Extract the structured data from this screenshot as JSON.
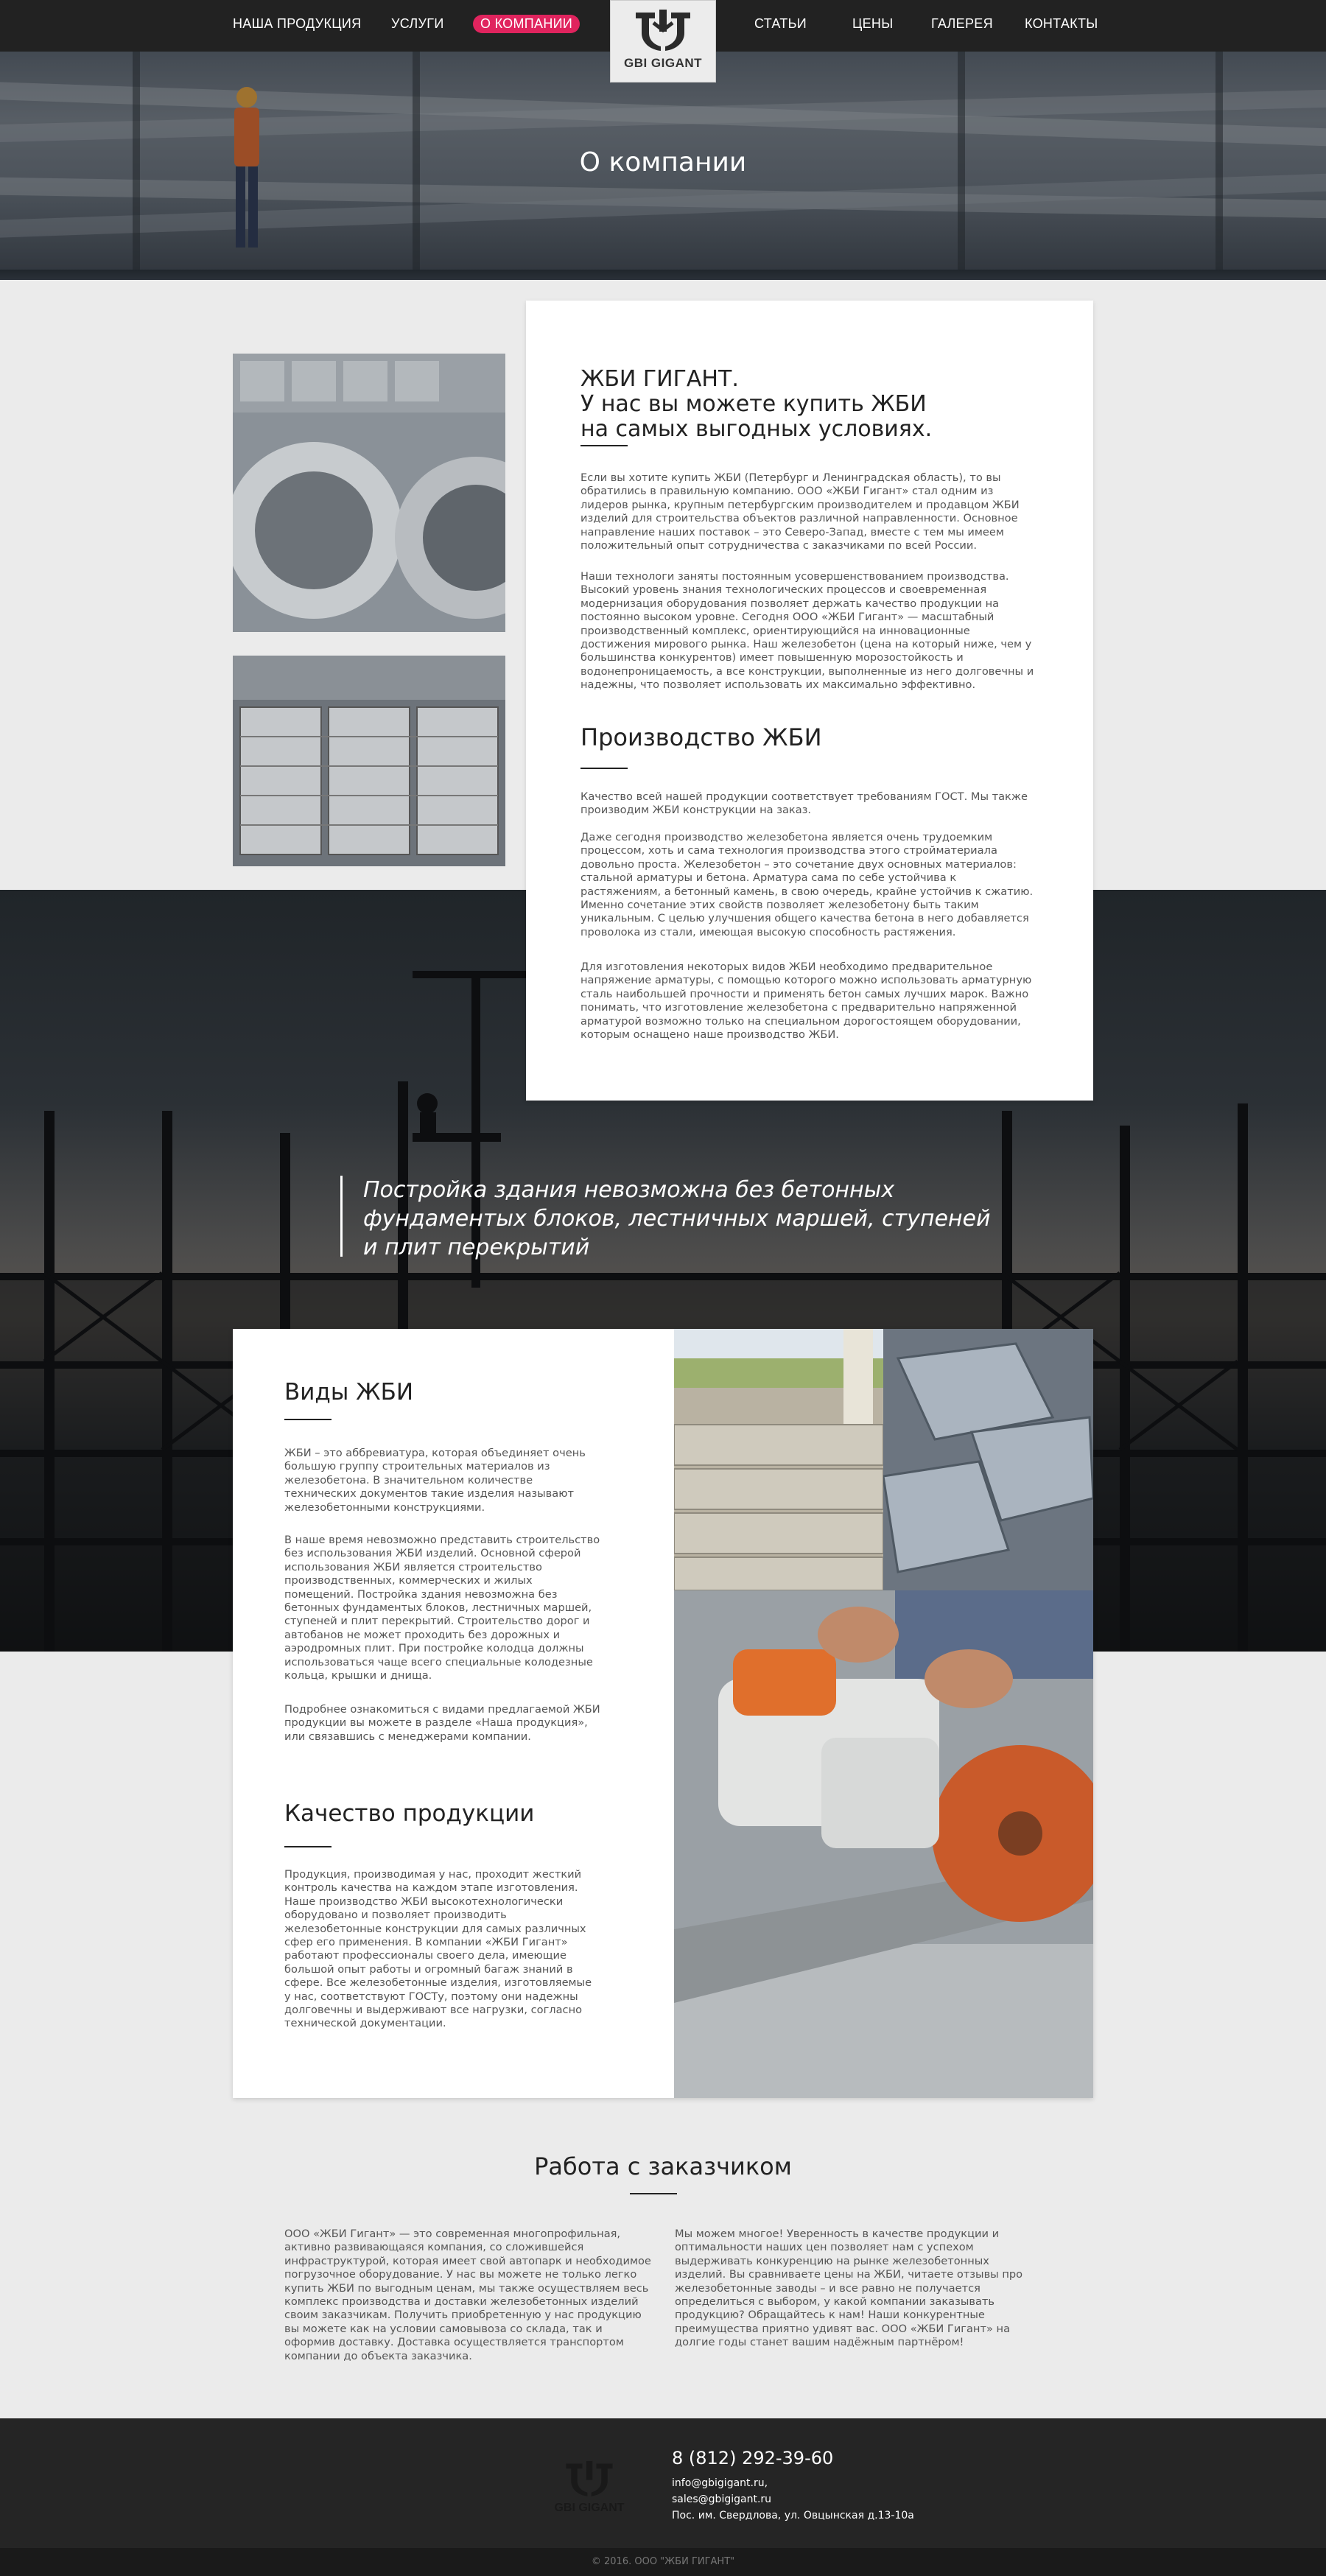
{
  "nav": {
    "items_left": [
      "НАША ПРОДУКЦИЯ",
      "УСЛУГИ",
      "О КОМПАНИИ"
    ],
    "items_right": [
      "СТАТЬИ",
      "ЦЕНЫ",
      "ГАЛЕРЕЯ",
      "КОНТАКТЫ"
    ],
    "active": "О КОМПАНИИ",
    "accent_color": "#e0245e",
    "logo_text": "GBI GIGANT"
  },
  "hero": {
    "title": "О компании"
  },
  "about": {
    "heading_lines": [
      "ЖБИ ГИГАНТ.",
      "У нас вы можете купить ЖБИ",
      "на самых выгодных условиях."
    ],
    "paragraphs": [
      "Если вы хотите купить ЖБИ (Петербург и Ленинградская область), то вы обратились в правильную компанию. ООО «ЖБИ Гигант» стал одним из лидеров рынка, крупным петербургским производителем и продавцом ЖБИ изделий для строительства объектов различной направленности. Основное направление наших поставок – это Северо-Запад, вместе с тем мы имеем положительный опыт сотрудничества с заказчиками по всей России.",
      "Наши технологи заняты постоянным усовершенствованием производства. Высокий уровень знания технологических процессов и своевременная модернизация оборудования позволяет держать качество продукции на постоянно высоком уровне. Сегодня ООО «ЖБИ Гигант» — масштабный производственный комплекс, ориентирующийся на инновационные достижения мирового рынка. Наш железобетон (цена на который ниже, чем у большинства конкурентов) имеет повышенную морозостойкость и водонепроницаемость, а все конструкции, выполненные из него долговечны и надежны, что позволяет использовать их максимально эффективно."
    ],
    "production_heading": "Производство ЖБИ",
    "production_paragraphs": [
      "Качество всей нашей продукции соответствует требованиям ГОСТ. Мы также производим ЖБИ конструкции на заказ.",
      "Даже сегодня производство железобетона является очень трудоемким процессом, хоть и сама технология производства этого стройматериала довольно проста. Железобетон – это сочетание двух основных материалов: стальной арматуры и бетона. Арматура сама по себе устойчива к растяжениям, а бетонный камень, в свою очередь, крайне устойчив к сжатию. Именно сочетание этих свойств позволяет железобетону быть таким уникальным. С целью улучшения общего качества бетона в него добавляется проволока из стали, имеющая высокую способность растяжения.",
      "Для изготовления некоторых видов ЖБИ необходимо предварительное напряжение арматуры, с помощью которого можно использовать арматурную сталь наибольшей прочности и применять бетон самых лучших марок. Важно  понимать, что изготовление железобетона с предварительно напряженной арматурой возможно только на специальном дорогостоящем оборудовании, которым оснащено наше производство ЖБИ."
    ]
  },
  "quote": {
    "lines": [
      "Постройка здания невозможна без бетонных",
      "фундаментых блоков, лестничных маршей, ступеней",
      "и плит перекрытий"
    ]
  },
  "types": {
    "heading": "Виды ЖБИ",
    "paragraphs": [
      "ЖБИ – это аббревиатура, которая объединяет очень большую группу строительных материалов из железобетона. В значительном количестве технических документов такие изделия называют железобетонными конструкциями.",
      "В наше время невозможно представить строительство без использования ЖБИ изделий. Основной сферой использования ЖБИ является строительство производственных, коммерческих и жилых помещений. Постройка здания невозможна без бетонных фундаментых блоков, лестничных маршей, ступеней и плит перекрытий. Строительство дорог и автобанов не может проходить без дорожных и аэродромных плит. При постройке колодца должны использоваться чаще всего специальные колодезные кольца, крышки и днища.",
      "Подробнее ознакомиться с видами предлагаемой ЖБИ продукции вы можете в разделе «Наша продукция», или связавшись с менеджерами компании."
    ],
    "quality_heading": "Качество продукции",
    "quality_paragraph": "Продукция, производимая у нас, проходит жесткий контроль качества на каждом этапе изготовления. Наше производство ЖБИ высокотехнологически оборудовано и позволяет производить железобетонные конструкции для самых различных сфер его применения. В компании «ЖБИ Гигант» работают профессионалы своего дела, имеющие большой опыт работы и огромный багаж знаний в сфере. Все железобетонные изделия, изготовляемые у нас, соответствуют ГОСТу, поэтому они надежны долговечны и выдерживают все нагрузки, согласно технической документации."
  },
  "customer": {
    "heading": "Работа с заказчиком",
    "left": "ООО «ЖБИ Гигант» — это современная многопрофильная, активно развивающаяся компания, со сложившейся инфраструктурой, которая имеет свой автопарк и необходимое погрузочное оборудование. У нас вы можете не только легко купить ЖБИ по выгодным ценам, мы также осуществляем весь комплекс производства и доставки железобетонных изделий своим заказчикам. Получить приобретенную у нас продукцию вы можете как на условии самовывоза со склада, так и оформив доставку. Доставка осуществляется транспортом компании до объекта заказчика.",
    "right": "Мы можем многое! Уверенность в качестве продукции и оптимальности наших цен позволяет нам с успехом выдерживать конкуренцию на рынке железобетонных изделий. Вы сравниваете цены на ЖБИ, читаете отзывы про железобетонные заводы – и все равно не получается определиться с выбором, у какой компании заказывать продукцию? Обращайтесь к нам! Наши конкурентные преимущества приятно удивят вас. ООО «ЖБИ Гигант» на долгие годы станет вашим надёжным партнёром!"
  },
  "footer": {
    "logo_text": "GBI GIGANT",
    "phone": "8 (812) 292-39-60",
    "email1": "info@gbigigant.ru,",
    "email2": "sales@gbigigant.ru",
    "address": "Пос. им. Свердлова, ул. Овцынская д.13-10а",
    "copyright": "© 2016. ООО \"ЖБИ ГИГАНТ\""
  }
}
